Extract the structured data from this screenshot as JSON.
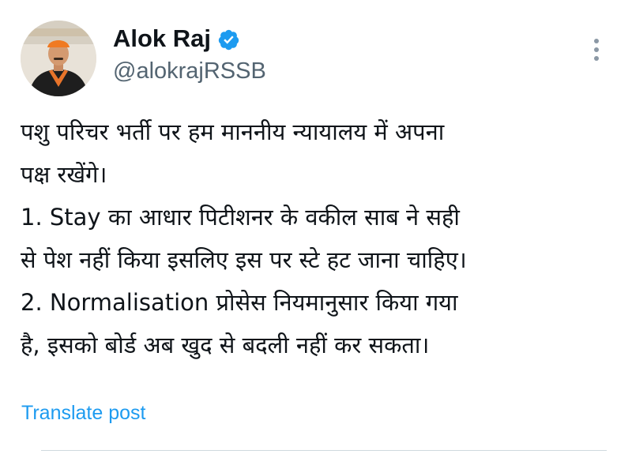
{
  "author": {
    "name": "Alok Raj",
    "handle": "@alokrajRSSB",
    "verified_color": "#1d9bf0"
  },
  "post": {
    "lines": [
      "पशु परिचर भर्ती पर हम माननीय न्यायालय में अपना",
      "पक्ष रखेंगे।",
      "1. Stay का आधार पिटीशनर के वकील साब ने सही",
      "से पेश नहीं किया इसलिए इस पर स्टे हट जाना चाहिए।",
      "2. Normalisation प्रोसेस नियमानुसार किया गया",
      "है, इसको बोर्ड अब खुद से बदली नहीं कर सकता।"
    ]
  },
  "actions": {
    "translate_label": "Translate post",
    "more_icon": "more-vertical-icon"
  },
  "colors": {
    "text": "#0f1419",
    "secondary": "#536471",
    "accent": "#1d9bf0",
    "divider": "#cfd9de"
  }
}
